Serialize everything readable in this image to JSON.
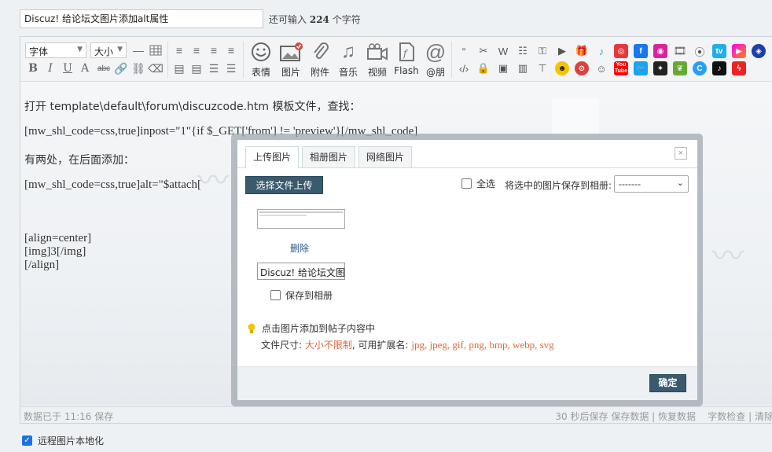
{
  "title": {
    "value": "Discuz! 给论坛文图片添加alt属性",
    "remaining_prefix": "还可输入",
    "remaining_count": "224",
    "remaining_suffix": "个字符"
  },
  "toolbar": {
    "font_label": "字体",
    "size_label": "大小",
    "emoji_label": "表情",
    "image_label": "图片",
    "attach_label": "附件",
    "music_label": "音乐",
    "video_label": "视频",
    "flash_label": "Flash",
    "at_label": "@朋",
    "strike_label": "abc",
    "brand_colors": {
      "netease": "#e4393c",
      "facebook": "#1877f2",
      "instagram": "#d6249f",
      "bilibili": "#20b0e3",
      "youtube": "#ff0000",
      "twitter": "#1da1f2",
      "tiktok": "#111111"
    },
    "youtube_label": "You Tube"
  },
  "content": {
    "lines": [
      "打开 template\\default\\forum\\discuzcode.htm 模板文件，查找：",
      "[mw_shl_code=css,true]inpost=\"1\"{if $_GET['from'] != 'preview'}[/mw_shl_code]",
      "有两处，在后面添加：",
      "[mw_shl_code=css,true]alt=\"$attach[",
      "[align=center]",
      "[img]3[/img]",
      "[/align]"
    ]
  },
  "status": {
    "saved": "数据已于 11:16 保存",
    "autosave": "30 秒后保存",
    "save_data": "保存数据",
    "restore": "恢复数据",
    "wordcount": "字数检查",
    "clear": "清除"
  },
  "remote_local": {
    "label": "远程图片本地化",
    "checked": true
  },
  "dialog": {
    "tabs": [
      "上传图片",
      "相册图片",
      "网络图片"
    ],
    "active_tab": 0,
    "close": "×",
    "upload_button": "选择文件上传",
    "select_all": "全选",
    "save_to_album_prompt": "将选中的图片保存到相册:",
    "album_value": "-------",
    "delete": "删除",
    "alt_value": "Discuz! 给论坛文图片",
    "save_album": "保存到相册",
    "tip": "点击图片添加到帖子内容中",
    "file_size_label": "文件尺寸:",
    "file_size_value": "大小不限制",
    "ext_label": ", 可用扩展名:",
    "ext_value": "jpg, jpeg, gif, png, bmp, webp, svg",
    "ok": "确定",
    "accent": "#3a5a6e"
  }
}
